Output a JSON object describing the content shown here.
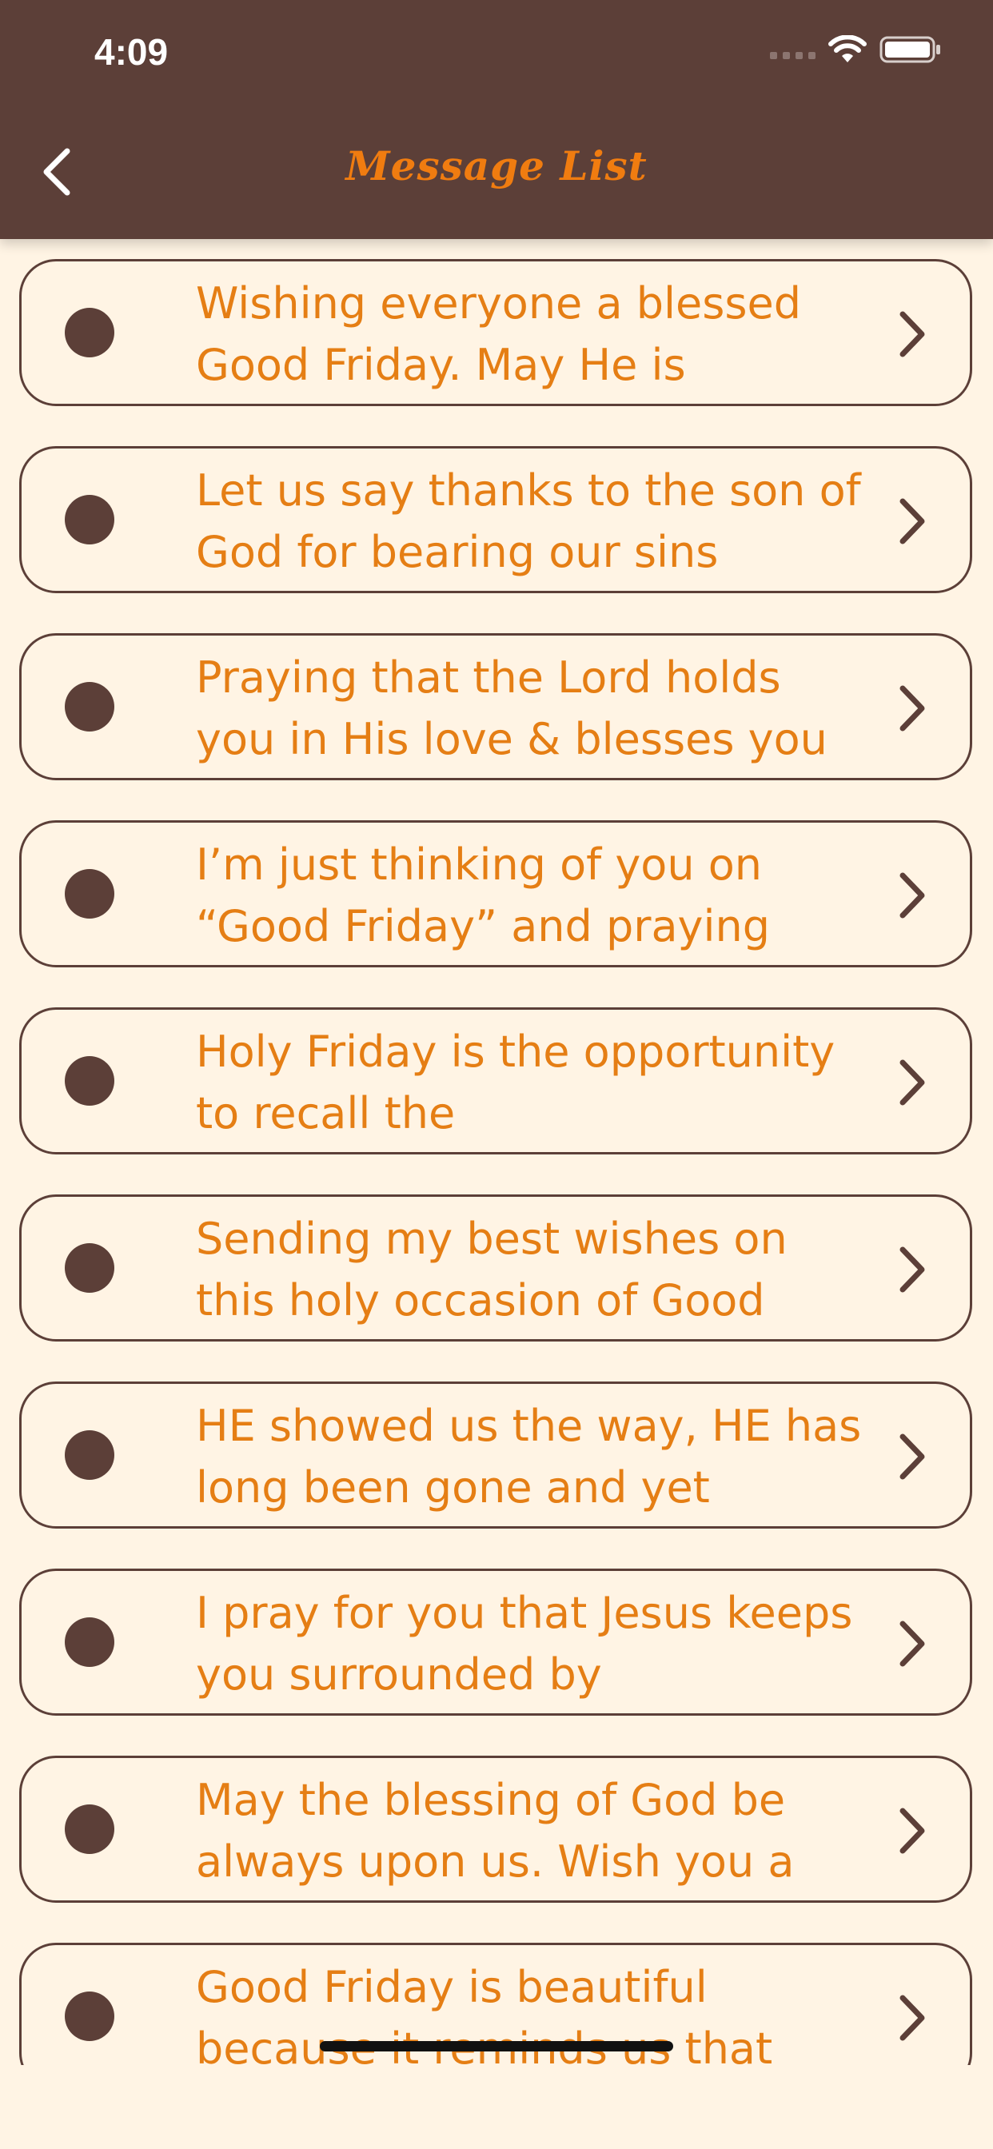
{
  "status_bar": {
    "time": "4:09"
  },
  "header": {
    "title": "Message List",
    "back_icon": "chevron-left-icon"
  },
  "colors": {
    "header_bg": "#5C3F38",
    "page_bg": "#FFF4E4",
    "accent_text": "#E57E14",
    "title_text": "#F07C10"
  },
  "messages": [
    {
      "text": "Wishing everyone a blessed Good Friday. May He is"
    },
    {
      "text": "Let us say thanks to the son of God for bearing our sins"
    },
    {
      "text": "Praying that the Lord holds you in His love & blesses you"
    },
    {
      "text": "I’m just thinking of you on “Good Friday” and praying"
    },
    {
      "text": "Holy Friday is the opportunity to recall the"
    },
    {
      "text": "Sending my best wishes on this holy occasion of Good"
    },
    {
      "text": "HE showed us the way, HE has long been gone and yet"
    },
    {
      "text": "I pray for you that Jesus keeps you surrounded by"
    },
    {
      "text": "May the blessing of God be always upon us. Wish you a"
    },
    {
      "text": "Good Friday is beautiful because it reminds us that"
    }
  ]
}
